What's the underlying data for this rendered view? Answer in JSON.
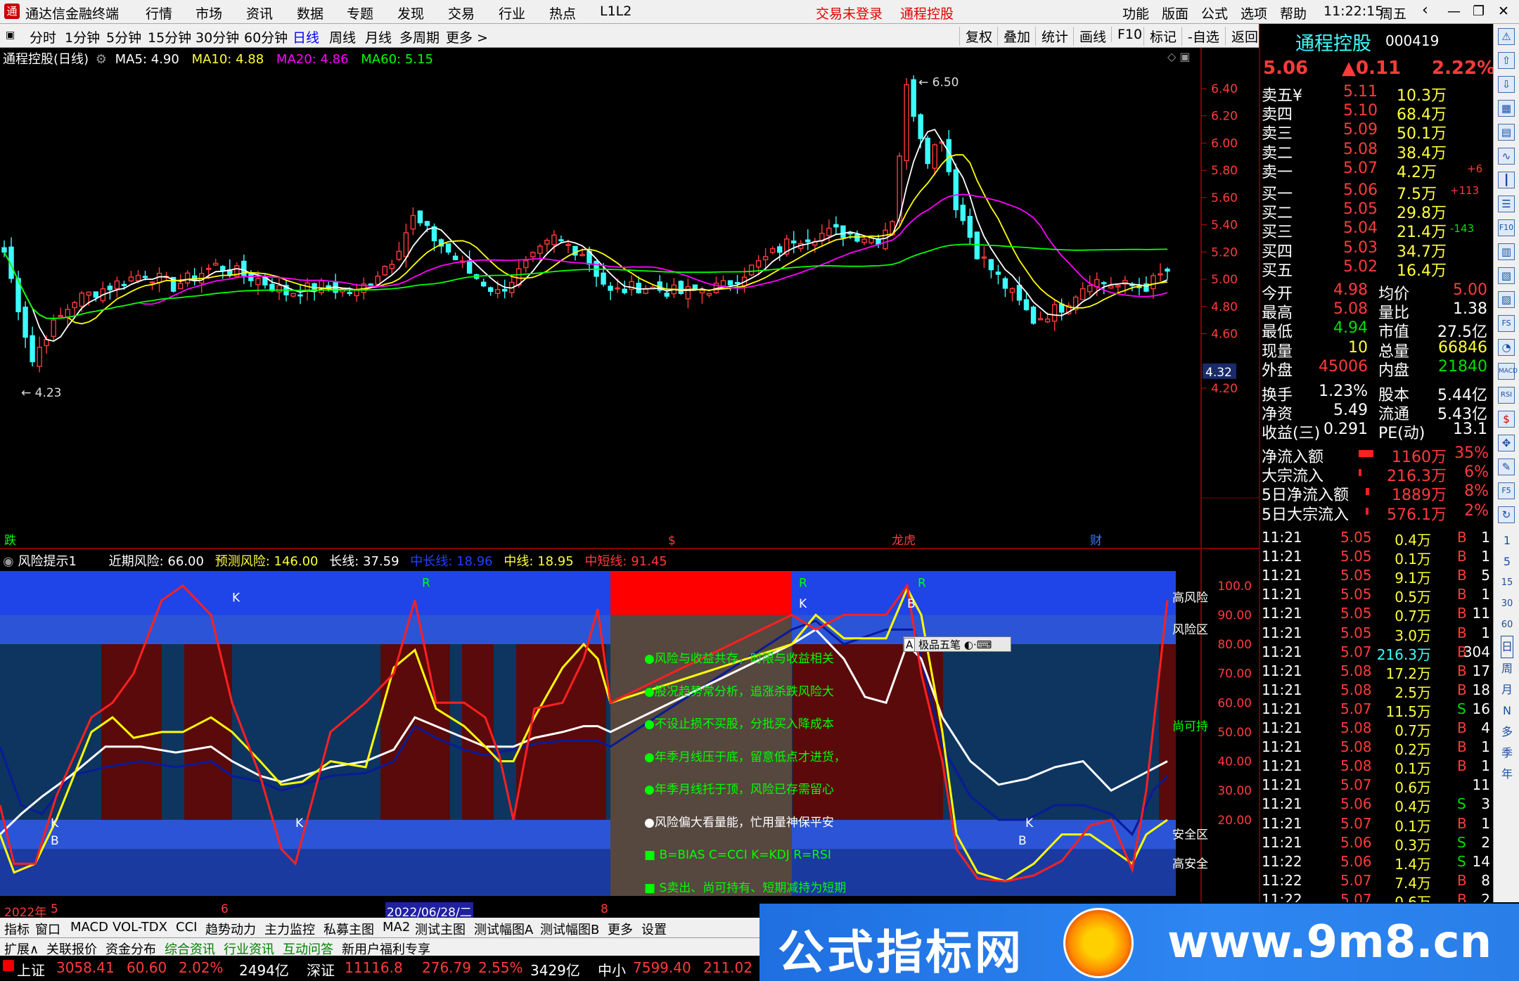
{
  "menubar": {
    "app_title": "通达信金融终端",
    "items": [
      "行情",
      "市场",
      "资讯",
      "数据",
      "专题",
      "发现",
      "交易",
      "行业",
      "热点",
      "L1L2"
    ],
    "status_left": "交易未登录",
    "status_right": "通程控股",
    "right_items": [
      "功能",
      "版面",
      "公式",
      "选项",
      "帮助"
    ],
    "time": "11:22:15",
    "weekday": "周五"
  },
  "tabbar": {
    "tabs": [
      "分时",
      "1分钟",
      "5分钟",
      "15分钟",
      "30分钟",
      "60分钟",
      "日线",
      "周线",
      "月线",
      "多周期",
      "更多 >"
    ],
    "active": "日线",
    "buttons": [
      "复权",
      "叠加",
      "统计",
      "画线",
      "F10",
      "标记",
      "-自选",
      "返回"
    ]
  },
  "main_chart": {
    "title": "通程控股(日线)",
    "ma5": "MA5: 4.90",
    "ma10": "MA10: 4.88",
    "ma20": "MA20: 4.86",
    "ma60": "MA60: 5.15",
    "high_label": "6.50",
    "low_label": "4.23",
    "current_price_tag": "4.32",
    "y_ticks": [
      "6.40",
      "6.20",
      "6.00",
      "5.80",
      "5.60",
      "5.40",
      "5.20",
      "5.00",
      "4.80",
      "4.60",
      "4.20"
    ],
    "markers": [
      "跌",
      "$",
      "龙虎",
      "财"
    ],
    "colors": {
      "up": "#ff3b3b",
      "down": "#3bffff",
      "ma5": "#ffffff",
      "ma10": "#ffff00",
      "ma20": "#ff00ff",
      "ma60": "#00ff00"
    }
  },
  "indicator": {
    "name": "风险提示1",
    "near_risk": "近期风险: 66.00",
    "forecast_risk": "预测风险: 146.00",
    "long_line": "长线: 37.59",
    "mid_long": "中长线: 18.96",
    "mid_line": "中线: 18.95",
    "mid_short": "中短线: 91.45",
    "y_ticks": [
      "100.0",
      "90.00",
      "80.00",
      "70.00",
      "60.00",
      "50.00",
      "40.00",
      "30.00",
      "20.00"
    ],
    "zone_labels": [
      "高风险",
      "风险区",
      "尚可持",
      "安全区",
      "高安全"
    ],
    "notes": [
      "●风险与收益共存，时限与收益相关",
      "●股况趋势常分析，追涨杀跌风险大",
      "●不设止损不买股，分批买入降成本",
      "●年季月线压于底，留意低点才进货，",
      "●年季月线托于顶，风险已存需留心",
      "●风险偏大看量能，忙用量神保平安",
      "■ B=BIAS C=CCI K=KDJ R=RSI",
      "■ S卖出、尚可持有、短期减持为短期行为"
    ],
    "popup": "极品五笔",
    "letters": [
      "K",
      "K",
      "K",
      "B",
      "K",
      "B",
      "R",
      "R",
      "R",
      "K",
      "B"
    ]
  },
  "date_axis": {
    "labels": [
      "2022年",
      "5",
      "6",
      "2022/06/28/二",
      "8"
    ]
  },
  "quote": {
    "name": "通程控股",
    "code": "000419",
    "price": "5.06",
    "change": "▲0.11",
    "pct": "2.22%",
    "asks": [
      {
        "label": "卖五",
        "mark": "¥",
        "price": "5.11",
        "vol": "10.3万",
        "delta": ""
      },
      {
        "label": "卖四",
        "mark": "",
        "price": "5.10",
        "vol": "68.4万",
        "delta": ""
      },
      {
        "label": "卖三",
        "mark": "",
        "price": "5.09",
        "vol": "50.1万",
        "delta": ""
      },
      {
        "label": "卖二",
        "mark": "",
        "price": "5.08",
        "vol": "38.4万",
        "delta": ""
      },
      {
        "label": "卖一",
        "mark": "",
        "price": "5.07",
        "vol": "4.2万",
        "delta": "+6"
      }
    ],
    "bids": [
      {
        "label": "买一",
        "price": "5.06",
        "vol": "7.5万",
        "delta": "+113"
      },
      {
        "label": "买二",
        "price": "5.05",
        "vol": "29.8万",
        "delta": ""
      },
      {
        "label": "买三",
        "price": "5.04",
        "vol": "21.4万",
        "delta": "-143"
      },
      {
        "label": "买四",
        "price": "5.03",
        "vol": "34.7万",
        "delta": ""
      },
      {
        "label": "买五",
        "price": "5.02",
        "vol": "16.4万",
        "delta": ""
      }
    ],
    "stats": [
      {
        "k1": "今开",
        "v1": "4.98",
        "k2": "均价",
        "v2": "5.00"
      },
      {
        "k1": "最高",
        "v1": "5.08",
        "k2": "量比",
        "v2": "1.38"
      },
      {
        "k1": "最低",
        "v1": "4.94",
        "k2": "市值",
        "v2": "27.5亿"
      },
      {
        "k1": "现量",
        "v1": "10",
        "k2": "总量",
        "v2": "66846"
      },
      {
        "k1": "外盘",
        "v1": "45006",
        "k2": "内盘",
        "v2": "21840"
      }
    ],
    "stats2": [
      {
        "k1": "换手",
        "v1": "1.23%",
        "k2": "股本",
        "v2": "5.44亿"
      },
      {
        "k1": "净资",
        "v1": "5.49",
        "k2": "流通",
        "v2": "5.43亿"
      },
      {
        "k1": "收益(三)",
        "v1": "0.291",
        "k2": "PE(动)",
        "v2": "13.1"
      }
    ],
    "flows": [
      {
        "label": "净流入额",
        "val": "1160万",
        "pct": "35%",
        "bar": 0.35
      },
      {
        "label": "大宗流入",
        "val": "216.3万",
        "pct": "6%",
        "bar": 0.06
      },
      {
        "label": "5日净流入额",
        "val": "1889万",
        "pct": "8%",
        "bar": 0.08
      },
      {
        "label": "5日大宗流入",
        "val": "576.1万",
        "pct": "2%",
        "bar": 0.02
      }
    ],
    "ticks": [
      {
        "t": "11:21",
        "p": "5.05",
        "v": "0.4万",
        "d": "B",
        "n": "1"
      },
      {
        "t": "11:21",
        "p": "5.05",
        "v": "0.1万",
        "d": "B",
        "n": "1"
      },
      {
        "t": "11:21",
        "p": "5.05",
        "v": "9.1万",
        "d": "B",
        "n": "5"
      },
      {
        "t": "11:21",
        "p": "5.05",
        "v": "0.5万",
        "d": "B",
        "n": "1"
      },
      {
        "t": "11:21",
        "p": "5.05",
        "v": "0.7万",
        "d": "B",
        "n": "11"
      },
      {
        "t": "11:21",
        "p": "5.05",
        "v": "3.0万",
        "d": "B",
        "n": "1"
      },
      {
        "t": "11:21",
        "p": "5.07",
        "v": "216.3万",
        "d": "B",
        "n": "304"
      },
      {
        "t": "11:21",
        "p": "5.08",
        "v": "17.2万",
        "d": "B",
        "n": "17"
      },
      {
        "t": "11:21",
        "p": "5.08",
        "v": "2.5万",
        "d": "B",
        "n": "18"
      },
      {
        "t": "11:21",
        "p": "5.07",
        "v": "11.5万",
        "d": "S",
        "n": "16"
      },
      {
        "t": "11:21",
        "p": "5.08",
        "v": "0.7万",
        "d": "B",
        "n": "4"
      },
      {
        "t": "11:21",
        "p": "5.08",
        "v": "0.2万",
        "d": "B",
        "n": "1"
      },
      {
        "t": "11:21",
        "p": "5.08",
        "v": "0.1万",
        "d": "B",
        "n": "1"
      },
      {
        "t": "11:21",
        "p": "5.07",
        "v": "0.6万",
        "d": "",
        "n": "11"
      },
      {
        "t": "11:21",
        "p": "5.06",
        "v": "0.4万",
        "d": "S",
        "n": "3"
      },
      {
        "t": "11:21",
        "p": "5.07",
        "v": "0.1万",
        "d": "B",
        "n": "1"
      },
      {
        "t": "11:21",
        "p": "5.06",
        "v": "0.3万",
        "d": "S",
        "n": "2"
      },
      {
        "t": "11:22",
        "p": "5.06",
        "v": "1.4万",
        "d": "S",
        "n": "14"
      },
      {
        "t": "11:22",
        "p": "5.07",
        "v": "7.4万",
        "d": "B",
        "n": "8"
      },
      {
        "t": "11:22",
        "p": "5.07",
        "v": "0.6万",
        "d": "B",
        "n": "2"
      }
    ]
  },
  "toolcol": {
    "labels": [
      "日",
      "周",
      "月",
      "N",
      "多",
      "季",
      "年"
    ],
    "numbers": [
      "1",
      "5",
      "15",
      "30",
      "60"
    ]
  },
  "bottom": {
    "tabs": [
      "指标",
      "窗口",
      "MACD",
      "VOL-TDX",
      "CCI",
      "趋势动力",
      "主力监控",
      "私募主图",
      "MA2",
      "测试主图",
      "测试幅图A",
      "测试幅图B",
      "更多",
      "设置"
    ],
    "tabs2": [
      "扩展∧",
      "关联报价",
      "资金分布",
      "综合资讯",
      "行业资讯",
      "互动问答",
      "新用户福利专享"
    ],
    "indices": [
      {
        "name": "上证",
        "val": "3058.41",
        "chg": "60.60",
        "pct": "2.02%",
        "amt": "2494亿"
      },
      {
        "name": "深证",
        "val": "11116.8",
        "chg": "276.79",
        "pct": "2.55%",
        "amt": "3429亿"
      },
      {
        "name": "中小",
        "val": "7599.40",
        "chg": "211.02",
        "pct": "",
        "amt": ""
      }
    ],
    "ad_text": "公式指标网",
    "ad_url": "www.9m8.cn"
  }
}
